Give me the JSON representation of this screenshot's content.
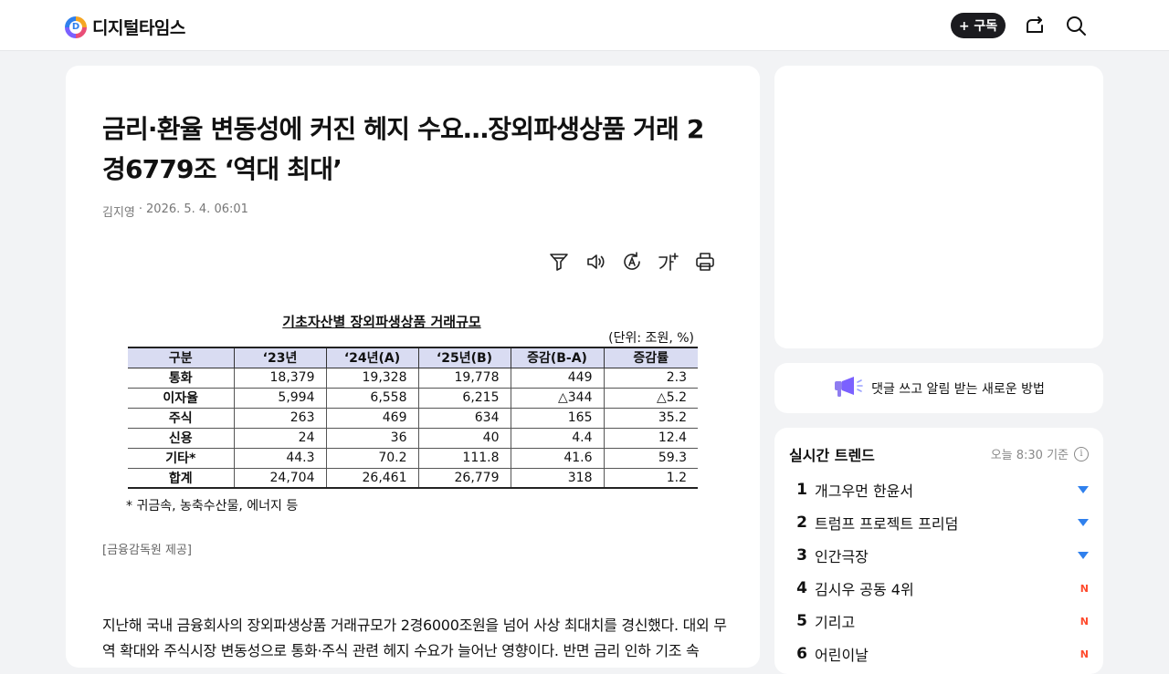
{
  "header": {
    "logo_letter": "D",
    "logo_text": "디지털타임스",
    "subscribe_label": "+ 구독",
    "share_icon": "share-icon",
    "search_icon": "search-icon"
  },
  "article": {
    "title": "금리·환율 변동성에 커진 헤지 수요…장외파생상품 거래 2경6779조 ‘역대 최대’",
    "author": "김지영",
    "separator": "·",
    "date": "2026. 5. 4. 06:01",
    "tools": [
      {
        "icon": "filter-icon"
      },
      {
        "icon": "speaker-icon"
      },
      {
        "icon": "translate-icon"
      },
      {
        "icon": "font-size-icon"
      },
      {
        "icon": "print-icon"
      }
    ],
    "figure": {
      "title": "기초자산별 장외파생상품 거래규모",
      "unit": "(단위: 조원, %)",
      "headers": [
        "구분",
        "‘23년",
        "‘24년(A)",
        "‘25년(B)",
        "증감(B-A)",
        "증감률"
      ],
      "rows": [
        {
          "label": "통화",
          "values": [
            "18,379",
            "19,328",
            "19,778",
            "449",
            "2.3"
          ]
        },
        {
          "label": "이자율",
          "values": [
            "5,994",
            "6,558",
            "6,215",
            "△344",
            "△5.2"
          ]
        },
        {
          "label": "주식",
          "values": [
            "263",
            "469",
            "634",
            "165",
            "35.2"
          ]
        },
        {
          "label": "신용",
          "values": [
            "24",
            "36",
            "40",
            "4.4",
            "12.4"
          ]
        },
        {
          "label": "기타*",
          "values": [
            "44.3",
            "70.2",
            "111.8",
            "41.6",
            "59.3"
          ]
        },
        {
          "label": "합계",
          "values": [
            "24,704",
            "26,461",
            "26,779",
            "318",
            "1.2"
          ]
        }
      ],
      "note": "* 귀금속, 농축수산물, 에너지 등"
    },
    "credit": "[금융감독원 제공]",
    "body": "지난해 국내 금융회사의 장외파생상품 거래규모가 2경6000조원을 넘어 사상 최대치를 경신했다. 대외 무역 확대와 주식시장 변동성으로 통화·주식 관련 헤지 수요가 늘어난 영향이다. 반면 금리 인하 기조 속"
  },
  "sidebar": {
    "notice": "댓글 쓰고 알림 받는 새로운 방법",
    "notice_icon": "megaphone-icon",
    "trend": {
      "title": "실시간 트렌드",
      "time": "오늘 8:30 기준",
      "info_icon": "info-icon",
      "items": [
        {
          "rank": "1",
          "keyword": "개그우먼 한윤서",
          "status": "down"
        },
        {
          "rank": "2",
          "keyword": "트럼프 프로젝트 프리덤",
          "status": "down"
        },
        {
          "rank": "3",
          "keyword": "인간극장",
          "status": "down"
        },
        {
          "rank": "4",
          "keyword": "김시우 공동 4위",
          "status": "new"
        },
        {
          "rank": "5",
          "keyword": "기리고",
          "status": "new"
        },
        {
          "rank": "6",
          "keyword": "어린이날",
          "status": "new"
        }
      ],
      "new_label": "N",
      "colors": {
        "down": "#2f80ed",
        "new": "#ff4a2c"
      }
    }
  }
}
